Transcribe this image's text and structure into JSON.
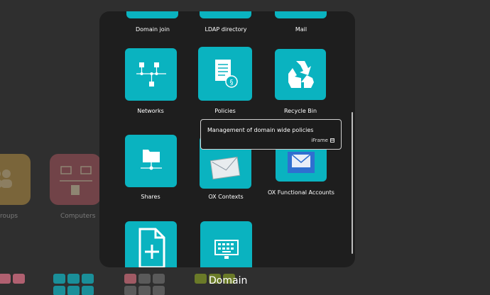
{
  "background": {
    "groups_label": "roups",
    "computers_label": "Computers",
    "dock_title": "Domain"
  },
  "modal": {
    "top_row": [
      "Domain join",
      "LDAP directory",
      "Mail"
    ],
    "tiles": [
      {
        "label": "Networks",
        "icon": "network-icon"
      },
      {
        "label": "Policies",
        "icon": "policy-document-icon"
      },
      {
        "label": "Recycle Bin",
        "icon": "recycle-icon"
      },
      {
        "label": "Shares",
        "icon": "folder-share-icon"
      },
      {
        "label": "OX Contexts",
        "icon": "mail-envelope-icon"
      },
      {
        "label": "OX Functional Accounts",
        "icon": "mail-window-icon"
      },
      {
        "label": "",
        "icon": "add-document-icon"
      },
      {
        "label": "",
        "icon": "keyboard-monitor-icon"
      }
    ]
  },
  "tooltip": {
    "text": "Management of domain wide policies",
    "type": "iFrame"
  },
  "colors": {
    "tile": "#0ab3c0",
    "modal_bg": "#1e1e1e",
    "page_bg": "#2f2f2f"
  }
}
